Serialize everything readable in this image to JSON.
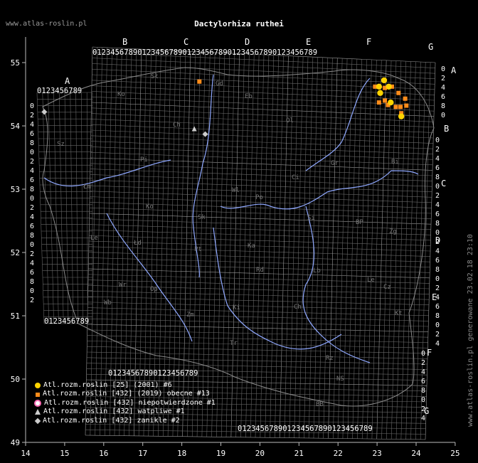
{
  "site": "www.atlas-roslin.pl",
  "title": "Dactylorhiza ruthei",
  "generated": "www.atlas-roslin.pl generowane 23.02.18 23:10",
  "axes": {
    "x_ticks": [
      "14",
      "15",
      "16",
      "17",
      "18",
      "19",
      "20",
      "21",
      "22",
      "23",
      "24",
      "25"
    ],
    "y_ticks": [
      "55",
      "54",
      "53",
      "52",
      "51",
      "50",
      "49"
    ]
  },
  "grid_letters": {
    "columns": [
      "A",
      "B",
      "C",
      "D",
      "E",
      "F",
      "G"
    ],
    "rows": [
      "A",
      "B",
      "C",
      "D",
      "E",
      "F",
      "G"
    ]
  },
  "digit_string": "0123456789",
  "regions": [
    "Sł",
    "Gd",
    "Ko",
    "Eb",
    "Ch",
    "Ol",
    "Sz",
    "Pi",
    "Bi",
    "Ci",
    "Gr",
    "Wl",
    "Łm",
    "Po",
    "Ko",
    "Sk",
    "Si",
    "BP",
    "Zg",
    "Le",
    "Łd",
    "Ka",
    "Pt",
    "Rd",
    "Lb",
    "Le",
    "Wr",
    "Op",
    "Wb",
    "Cz",
    "Ki",
    "Ch",
    "Zm",
    "Kt",
    "Tr",
    "Rz",
    "NS",
    "BB"
  ],
  "legend": [
    {
      "symbol": "yellow-dot",
      "label": "Atl.rozm.roslin [25] (2001) #6"
    },
    {
      "symbol": "orange-square",
      "label": "Atl.rozm.roslin [432] (2019) obecne #13"
    },
    {
      "symbol": "pink-ring",
      "label": "Atl.rozm.roslin [432] niepotwierdzone #1"
    },
    {
      "symbol": "grey-triangle",
      "label": "Atl.rozm.roslin [432] watpliwe #1"
    },
    {
      "symbol": "grey-diamond",
      "label": "Atl.rozm.roslin [432] zanikle #2"
    }
  ],
  "records": {
    "yellow_dots": [
      [
        23.18,
        54.72
      ],
      [
        23.05,
        54.62
      ],
      [
        23.3,
        54.62
      ],
      [
        23.08,
        54.52
      ],
      [
        23.35,
        54.37
      ],
      [
        23.62,
        54.15
      ]
    ],
    "orange_squares": [
      [
        18.45,
        54.7
      ],
      [
        22.95,
        54.62
      ],
      [
        23.2,
        54.6
      ],
      [
        23.38,
        54.62
      ],
      [
        23.55,
        54.52
      ],
      [
        23.72,
        54.43
      ],
      [
        23.05,
        54.37
      ],
      [
        23.2,
        54.4
      ],
      [
        23.28,
        54.33
      ],
      [
        23.48,
        54.3
      ],
      [
        23.6,
        54.3
      ],
      [
        23.75,
        54.32
      ],
      [
        23.62,
        54.2
      ]
    ],
    "grey_triangles": [
      [
        18.32,
        53.95
      ]
    ],
    "grey_diamonds": [
      [
        14.48,
        54.22
      ],
      [
        18.6,
        53.87
      ]
    ]
  },
  "colors": {
    "background": "#000000",
    "grid": "#666666",
    "rivers": "#8fa8ff",
    "borders": "#8a8a8a",
    "yellow": "#ffd400",
    "orange": "#ff8c1a",
    "grey": "#cccccc"
  }
}
